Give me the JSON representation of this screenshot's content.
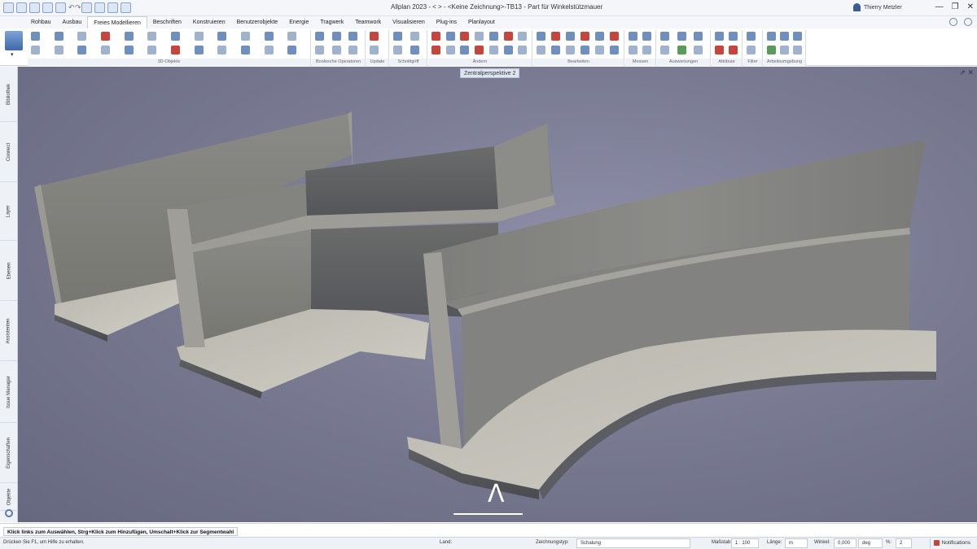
{
  "titlebar": {
    "title": "Allplan 2023 - <   > - <Keine Zeichnung>-TB13 - Part für Winkelstützmauer",
    "user": "Thierry Metzler",
    "minimize": "—",
    "restore": "❐",
    "close": "✕"
  },
  "tabs": [
    "Rohbau",
    "Ausbau",
    "Freies Modellieren",
    "Beschriften",
    "Konstruieren",
    "Benutzerobjekte",
    "Energie",
    "Tragwerk",
    "Teamwork",
    "Visualisieren",
    "Plug-ins",
    "Planlayout"
  ],
  "active_tab": "Freies Modellieren",
  "ribbon_groups": [
    "3D-Objekte",
    "Boolesche Operatoren",
    "Update",
    "Schnittgriff",
    "Ändern",
    "Bearbeiten",
    "Messen",
    "Auswertungen",
    "Attribute",
    "Filter",
    "Arbeitsumgebung"
  ],
  "viewport": {
    "title": "Zentralperspektive 2",
    "controls": "⇗ ✕",
    "annotation_mark": "Λ"
  },
  "sidebar": [
    "Bibliothek",
    "Connect",
    "Layer",
    "Ebenen",
    "Assistenten",
    "Issue Manager",
    "Eigenschaften",
    "Objekte"
  ],
  "hint": "Klick links zum Auswählen, Strg+Klick zum Hinzufügen, Umschalt+Klick zur Segmentwahl",
  "statusbar": {
    "help": "Drücken Sie F1, um Hilfe zu erhalten.",
    "land_label": "Land:",
    "drawing_type_label": "Zeichnungstyp:",
    "drawing_type_value": "Schalung",
    "scale_label": "Maßstab:",
    "scale_value": "1 : 100",
    "length_label": "Länge:",
    "length_value": "m",
    "angle_label": "Winkel:",
    "angle_value": "0,000",
    "angle_unit": "deg",
    "percent_label": "%:",
    "percent_value": "2",
    "notifications": "Notifications"
  },
  "colors": {
    "viewport_bg": "#7a7b93",
    "concrete": "#b9b6ab",
    "accent": "#3d6aab"
  }
}
